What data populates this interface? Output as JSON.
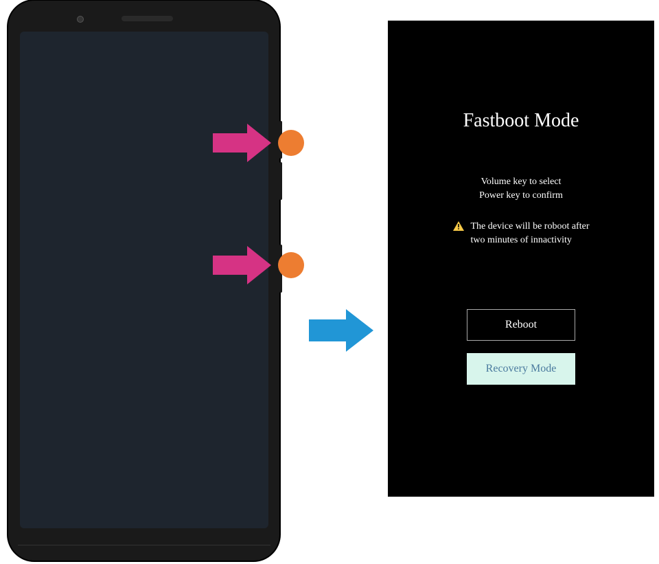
{
  "diagram": {
    "target_buttons": [
      "Volume button",
      "Power button"
    ]
  },
  "fastboot": {
    "title": "Fastboot Mode",
    "instruction_line1": "Volume key to select",
    "instruction_line2": "Power key to confirm",
    "warning_line1": "The device will be roboot after",
    "warning_line2": "two minutes of innactivity",
    "button_reboot": "Reboot",
    "button_recovery": "Recovery Mode"
  },
  "colors": {
    "press_arrow": "#d63384",
    "press_dot": "#ed7d31",
    "transition_arrow": "#2196d6",
    "recovery_bg": "#d8f5ec",
    "recovery_text": "#4a7a9e"
  }
}
